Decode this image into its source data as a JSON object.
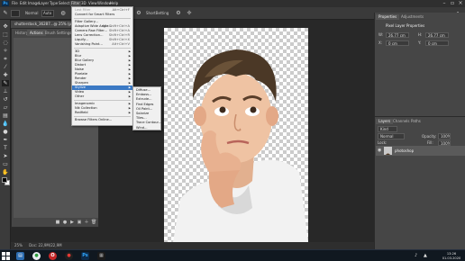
{
  "app": {
    "logo": "Ps"
  },
  "menubar": {
    "items": [
      "File",
      "Edit",
      "Image",
      "Layer",
      "Type",
      "Select",
      "Filter",
      "3D",
      "View",
      "Window",
      "Help"
    ]
  },
  "optionsbar": {
    "width_value": "Auto",
    "mode_label": "Normal",
    "shift_label": "Reset",
    "extra": "ShortBetting"
  },
  "document": {
    "tab_title": "shutterstock_36287...@ 25% (photoshop, RGB/8#) *"
  },
  "history_panel": {
    "tabs": [
      "History",
      "Actions",
      "Brush Settings",
      "Libraries"
    ]
  },
  "filter_menu": {
    "items": [
      {
        "label": "Last Filter",
        "shortcut": "Alt+Ctrl+F",
        "state": "disabled"
      },
      {
        "label": "Convert for Smart Filters",
        "state": "normal"
      },
      {
        "sep": true
      },
      {
        "label": "Filter Gallery...",
        "state": "normal"
      },
      {
        "label": "Adaptive Wide Angle...",
        "shortcut": "Alt+Shift+Ctrl+A",
        "state": "normal"
      },
      {
        "label": "Camera Raw Filter...",
        "shortcut": "Shift+Ctrl+A",
        "state": "normal"
      },
      {
        "label": "Lens Correction...",
        "shortcut": "Shift+Ctrl+R",
        "state": "normal"
      },
      {
        "label": "Liquify...",
        "shortcut": "Shift+Ctrl+X",
        "state": "normal"
      },
      {
        "label": "Vanishing Point...",
        "shortcut": "Alt+Ctrl+V",
        "state": "normal"
      },
      {
        "sep": true
      },
      {
        "label": "3D",
        "submenu": true,
        "state": "normal"
      },
      {
        "label": "Blur",
        "submenu": true,
        "state": "normal"
      },
      {
        "label": "Blur Gallery",
        "submenu": true,
        "state": "normal"
      },
      {
        "label": "Distort",
        "submenu": true,
        "state": "normal"
      },
      {
        "label": "Noise",
        "submenu": true,
        "state": "normal"
      },
      {
        "label": "Pixelate",
        "submenu": true,
        "state": "normal"
      },
      {
        "label": "Render",
        "submenu": true,
        "state": "normal"
      },
      {
        "label": "Sharpen",
        "submenu": true,
        "state": "normal"
      },
      {
        "label": "Stylize",
        "submenu": true,
        "state": "highlight"
      },
      {
        "label": "Video",
        "submenu": true,
        "state": "normal"
      },
      {
        "label": "Other",
        "submenu": true,
        "state": "normal"
      },
      {
        "sep": true
      },
      {
        "label": "Imagenomic",
        "submenu": true,
        "state": "normal"
      },
      {
        "label": "Nik Collection",
        "submenu": true,
        "state": "normal"
      },
      {
        "label": "Redfield",
        "submenu": true,
        "state": "normal"
      },
      {
        "sep": true
      },
      {
        "label": "Browse Filters Online...",
        "state": "normal"
      }
    ]
  },
  "stylize_menu": {
    "items": [
      "Diffuse...",
      "Emboss...",
      "Extrude...",
      "Find Edges",
      "Oil Paint...",
      "Solarize",
      "Tiles...",
      "Trace Contour...",
      "Wind..."
    ]
  },
  "properties_panel": {
    "tabs": [
      "Properties",
      "Adjustments"
    ],
    "title": "Pixel Layer Properties",
    "w_label": "W:",
    "w_value": "26,77 cm",
    "h_label": "H:",
    "h_value": "26,77 cm",
    "x_label": "X:",
    "x_value": "0 cm",
    "y_label": "Y:",
    "y_value": "0 cm"
  },
  "layers_panel": {
    "tabs": [
      "Layers",
      "Channels",
      "Paths"
    ],
    "kind_label": "Kind",
    "blend_mode": "Normal",
    "opacity_label": "Opacity:",
    "opacity_value": "100%",
    "lock_label": "Lock:",
    "fill_label": "Fill:",
    "fill_value": "100%",
    "layer_name": "photoshop"
  },
  "status": {
    "zoom": "25%",
    "doc": "Doc: 22,9M/22,9M"
  },
  "taskbar": {
    "time": "13:26",
    "date": "01.03.2020"
  }
}
